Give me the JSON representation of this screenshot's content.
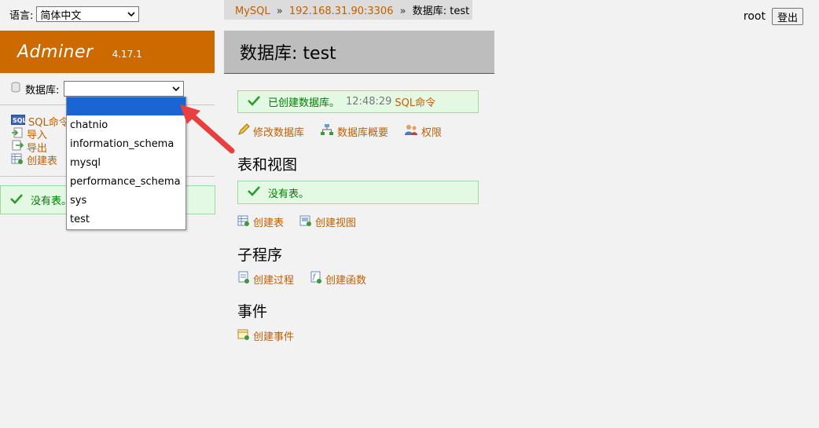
{
  "language": {
    "label": "语言:",
    "selected": "简体中文"
  },
  "breadcrumb": {
    "system": "MySQL",
    "server": "192.168.31.90:3306",
    "sep": "»",
    "current": "数据库: test"
  },
  "user": {
    "name": "root",
    "logout_label": "登出"
  },
  "logo": {
    "name": "Adminer",
    "version": "4.17.1"
  },
  "sidebar": {
    "db_label": "数据库:",
    "db_value": "",
    "links": [
      {
        "label": "SQL命令",
        "icon": "sql-icon"
      },
      {
        "label": "导入",
        "icon": "import-icon"
      },
      {
        "label": "导出",
        "icon": "export-icon"
      },
      {
        "label": "创建表",
        "icon": "create-table-icon"
      }
    ],
    "message": "没有表。"
  },
  "dropdown": {
    "options": [
      "",
      "chatnio",
      "information_schema",
      "mysql",
      "performance_schema",
      "sys",
      "test"
    ],
    "selected_index": 0
  },
  "main": {
    "title": "数据库: test",
    "created_message": "已创建数据库。",
    "created_time": "12:48:29",
    "sql_link": "SQL命令",
    "db_actions": [
      {
        "label": "修改数据库",
        "icon": "alter-db-icon"
      },
      {
        "label": "数据库概要",
        "icon": "schema-icon"
      },
      {
        "label": "权限",
        "icon": "privileges-icon"
      }
    ],
    "tables_heading": "表和视图",
    "tables_message": "没有表。",
    "table_actions": [
      {
        "label": "创建表",
        "icon": "create-table-icon"
      },
      {
        "label": "创建视图",
        "icon": "create-view-icon"
      }
    ],
    "routines_heading": "子程序",
    "routine_actions": [
      {
        "label": "创建过程",
        "icon": "create-procedure-icon"
      },
      {
        "label": "创建函数",
        "icon": "create-function-icon"
      }
    ],
    "events_heading": "事件",
    "event_actions": [
      {
        "label": "创建事件",
        "icon": "create-event-icon"
      }
    ]
  },
  "colors": {
    "accent": "#cc6a00",
    "link": "#c06000",
    "success": "#008000",
    "arrow": "#e8403f",
    "selection": "#1a64d3"
  }
}
